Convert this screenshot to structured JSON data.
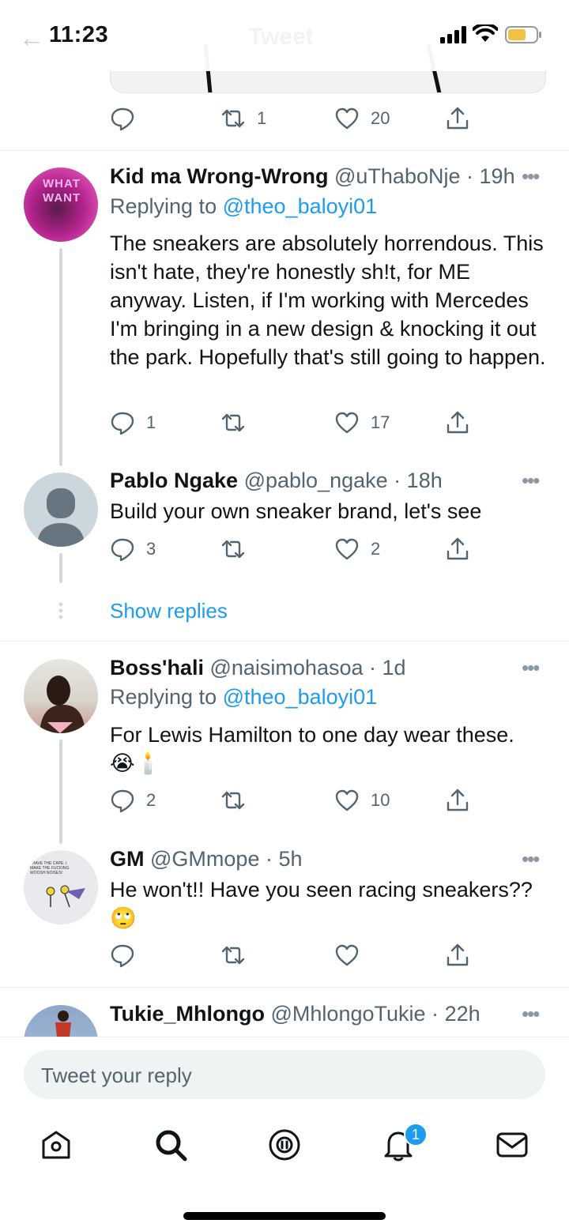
{
  "status_bar": {
    "time": "11:23",
    "ghost_title": "Tweet"
  },
  "top_tweet_actions": {
    "reply_count": "",
    "retweet_count": "1",
    "like_count": "20"
  },
  "replies": [
    {
      "name": "Kid ma Wrong-Wrong",
      "handle": "@uThaboNje",
      "time": "19h",
      "replying_prefix": "Replying to ",
      "replying_to": "@theo_baloyi01",
      "text": "The sneakers are absolutely horrendous. This isn't hate, they're honestly sh!t, for ME anyway. Listen, if I'm working with Mercedes I'm bringing in a new design & knocking it out the park. Hopefully that's still going to happen.",
      "reply_count": "1",
      "retweet_count": "",
      "like_count": "17",
      "avatar_text": "WHAT WANT"
    },
    {
      "name": "Pablo Ngake",
      "handle": "@pablo_ngake",
      "time": "18h",
      "text": "Build your own sneaker brand, let's see",
      "reply_count": "3",
      "retweet_count": "",
      "like_count": "2"
    },
    {
      "name": "Boss'hali",
      "handle": "@naisimohasoa",
      "time": "1d",
      "replying_prefix": "Replying to ",
      "replying_to": "@theo_baloyi01",
      "text": "For Lewis Hamilton to one day wear these.",
      "emoji": "😭🕯️",
      "reply_count": "2",
      "retweet_count": "",
      "like_count": "10"
    },
    {
      "name": "GM",
      "handle": "@GMmope",
      "time": "5h",
      "text": "He won't!! Have you seen racing sneakers??",
      "emoji": "🙄",
      "reply_count": "",
      "retweet_count": "",
      "like_count": "",
      "avatar_text": "I HAVE THE CAPE. I MAKE THE FUCKING WOOSH NOISES!"
    },
    {
      "name": "Tukie_Mhlongo",
      "handle": "@MhlongoTukie",
      "time": "22h"
    }
  ],
  "show_replies_label": "Show replies",
  "composer": {
    "placeholder": "Tweet your reply"
  },
  "tab_bar": {
    "items": [
      "home-icon",
      "search-icon",
      "spaces-icon",
      "notifications-icon",
      "messages-icon"
    ],
    "notification_badge": "1"
  },
  "colors": {
    "accent": "#1d9bf0",
    "muted": "#536471",
    "thread_line": "#cfd9de"
  }
}
